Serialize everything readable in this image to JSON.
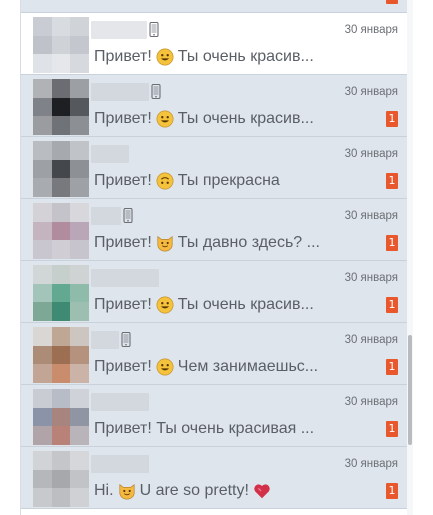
{
  "conversations": [
    {
      "date": "30 января",
      "text_before": "Привет!",
      "emoji": "grinning-face-emoji",
      "text_after": "Ты очень красив...",
      "unread": "",
      "active": true,
      "mobile": true,
      "avatar_colors": [
        "#c9ccd2",
        "#d8dbe0",
        "#d0d3d8",
        "#bfc3c9",
        "#cfd2d7",
        "#c4c8ce",
        "#dfe2e6",
        "#e5e7ea",
        "#d6d9de"
      ]
    },
    {
      "date": "30 января",
      "text_before": "Привет!",
      "emoji": "grinning-face-emoji",
      "text_after": "Ты очень красив...",
      "unread": "1",
      "active": false,
      "mobile": true,
      "avatar_colors": [
        "#b0b2b6",
        "#6b6d72",
        "#9c9fa4",
        "#7f8288",
        "#1e1f22",
        "#55585c",
        "#9a9ca0",
        "#6f7277",
        "#8c8f94"
      ]
    },
    {
      "date": "30 января",
      "text_before": "Привет!",
      "emoji": "upside-down-face-emoji",
      "text_after": "Ты прекрасна",
      "unread": "1",
      "active": false,
      "mobile": false,
      "avatar_colors": [
        "#b9bcc1",
        "#a6a9ae",
        "#c0c3c8",
        "#9da0a5",
        "#44474b",
        "#8d9095",
        "#a8abb0",
        "#78797c",
        "#9ea1a6"
      ]
    },
    {
      "date": "30 января",
      "text_before": "Привет!",
      "emoji": "cat-face-emoji",
      "text_after": "Ты давно здесь? ...",
      "unread": "1",
      "active": false,
      "mobile": true,
      "avatar_colors": [
        "#d4d2d6",
        "#c5c3ca",
        "#d8d7dc",
        "#c4b4bf",
        "#b08c9e",
        "#b9a7b8",
        "#c9c6cf",
        "#d0cdd4",
        "#c7c4cd"
      ]
    },
    {
      "date": "30 января",
      "text_before": "Привет!",
      "emoji": "grinning-face-emoji",
      "text_after": "Ты очень красив...",
      "unread": "1",
      "active": false,
      "mobile": false,
      "avatar_colors": [
        "#d1d7d6",
        "#c7cfcc",
        "#cfd3d4",
        "#a3c4b8",
        "#63a890",
        "#8fbcaa",
        "#7da896",
        "#3e8a72",
        "#9cbfb1"
      ]
    },
    {
      "date": "30 января",
      "text_before": "Привет!",
      "emoji": "grinning-face-emoji",
      "text_after": "Чем занимаешьс...",
      "unread": "1",
      "active": false,
      "mobile": true,
      "avatar_colors": [
        "#d9d6d4",
        "#bfa796",
        "#cdc5bf",
        "#ad8c77",
        "#9c6f53",
        "#b4927e",
        "#c2a594",
        "#c98d6e",
        "#cbb4a7"
      ]
    },
    {
      "date": "30 января",
      "text_before": "Привет! Ты очень красивая ...",
      "emoji": "",
      "text_after": "",
      "unread": "1",
      "active": false,
      "mobile": false,
      "avatar_colors": [
        "#c9ccd3",
        "#b7bcc6",
        "#cfd2d8",
        "#8a93a8",
        "#a7847d",
        "#8f95a3",
        "#b0a4a8",
        "#b98278",
        "#b9b4ba"
      ]
    },
    {
      "date": "30 января",
      "text_before": "Hi.",
      "emoji": "cat-face-emoji",
      "text_after": "U are so pretty!",
      "emoji2": "heart-emoji",
      "unread": "1",
      "active": false,
      "mobile": false,
      "avatar_colors": [
        "#d1d3d6",
        "#c4c6ca",
        "#d5d7da",
        "#b5b7bb",
        "#a6a8ac",
        "#c1c3c7",
        "#c7c9cc",
        "#bcbec2",
        "#cfd1d4"
      ]
    }
  ],
  "colors": {
    "unread_badge": "#e8582c",
    "row_background": "#dfe5ec",
    "active_row_background": "#ffffff",
    "text": "#5a5f66"
  }
}
